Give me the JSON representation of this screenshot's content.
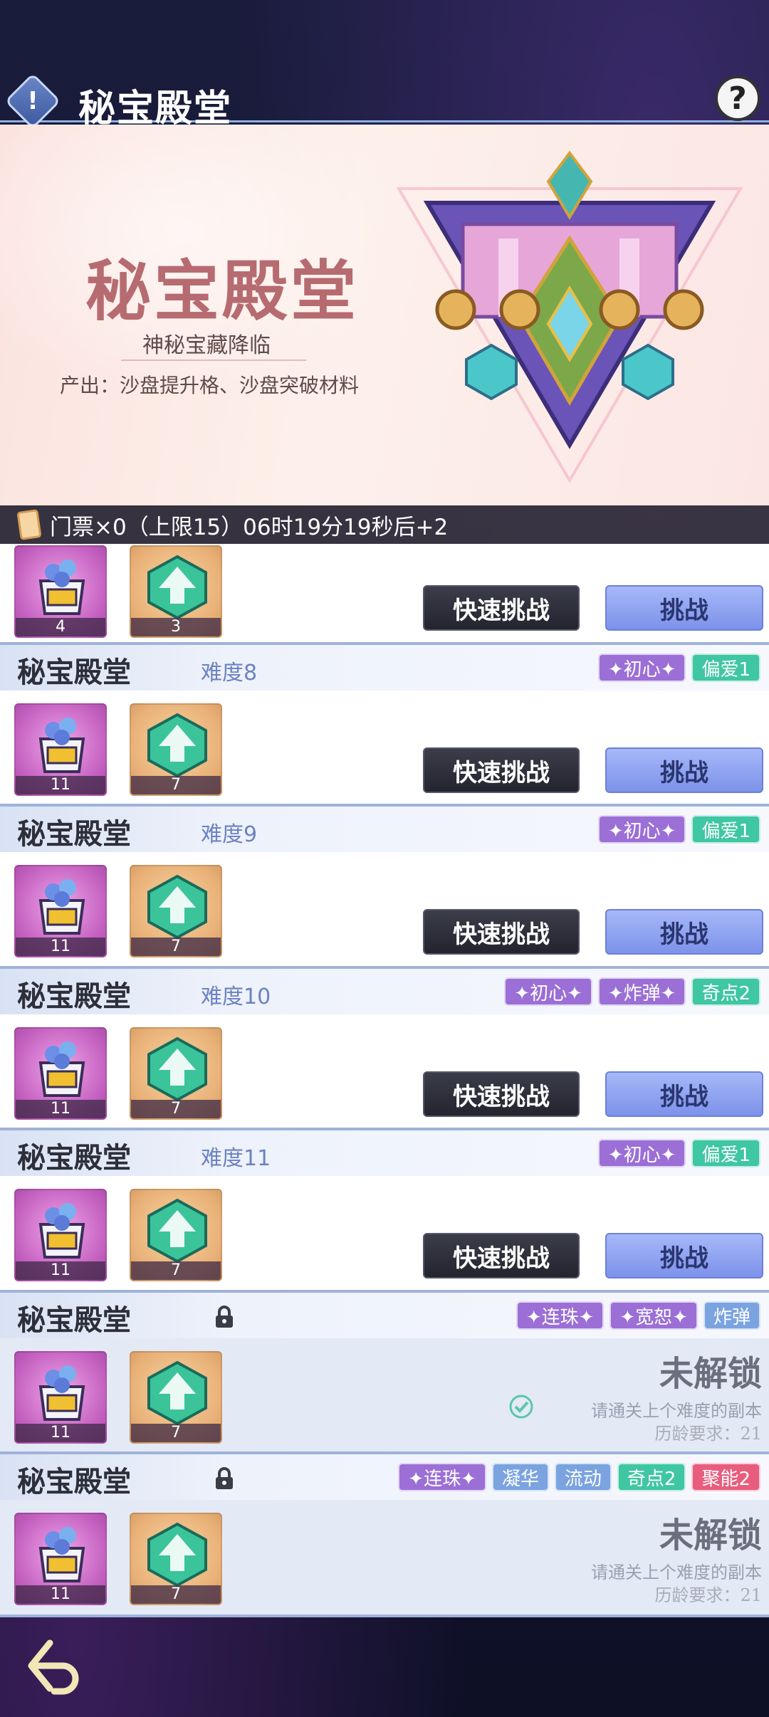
{
  "header": {
    "title": "秘宝殿堂",
    "info_glyph": "!",
    "help_glyph": "?"
  },
  "banner": {
    "title": "秘宝殿堂",
    "subtitle": "神秘宝藏降临",
    "output": "产出：沙盘提升格、沙盘突破材料"
  },
  "ticket": {
    "text": "门票×0（上限15）06时19分19秒后+2"
  },
  "buttons": {
    "quick": "快速挑战",
    "challenge": "挑战"
  },
  "locked": {
    "label": "未解锁",
    "hint": "请通关上个难度的副本",
    "requirement": "历龄要求：21"
  },
  "partial_card": {
    "item_counts": [
      "4",
      "3"
    ]
  },
  "cards": [
    {
      "name": "秘宝殿堂",
      "difficulty": "难度8",
      "tags": [
        {
          "text": "✦初心✦",
          "color": "purple"
        },
        {
          "text": "偏爱1",
          "color": "green"
        }
      ],
      "item_counts": [
        "11",
        "7"
      ]
    },
    {
      "name": "秘宝殿堂",
      "difficulty": "难度9",
      "tags": [
        {
          "text": "✦初心✦",
          "color": "purple"
        },
        {
          "text": "偏爱1",
          "color": "green"
        }
      ],
      "item_counts": [
        "11",
        "7"
      ]
    },
    {
      "name": "秘宝殿堂",
      "difficulty": "难度10",
      "tags": [
        {
          "text": "✦初心✦",
          "color": "purple"
        },
        {
          "text": "✦炸弹✦",
          "color": "purple"
        },
        {
          "text": "奇点2",
          "color": "green"
        }
      ],
      "item_counts": [
        "11",
        "7"
      ]
    },
    {
      "name": "秘宝殿堂",
      "difficulty": "难度11",
      "tags": [
        {
          "text": "✦初心✦",
          "color": "purple"
        },
        {
          "text": "偏爱1",
          "color": "green"
        }
      ],
      "item_counts": [
        "11",
        "7"
      ]
    },
    {
      "name": "秘宝殿堂",
      "tags": [
        {
          "text": "✦连珠✦",
          "color": "purple"
        },
        {
          "text": "✦宽恕✦",
          "color": "purple"
        },
        {
          "text": "炸弹",
          "color": "blue"
        }
      ],
      "item_counts": [
        "11",
        "7"
      ]
    },
    {
      "name": "秘宝殿堂",
      "tags": [
        {
          "text": "✦连珠✦",
          "color": "purple"
        },
        {
          "text": "凝华",
          "color": "blue"
        },
        {
          "text": "流动",
          "color": "blue"
        },
        {
          "text": "奇点2",
          "color": "green"
        },
        {
          "text": "聚能2",
          "color": "red"
        }
      ],
      "item_counts": [
        "11",
        "7"
      ]
    }
  ]
}
